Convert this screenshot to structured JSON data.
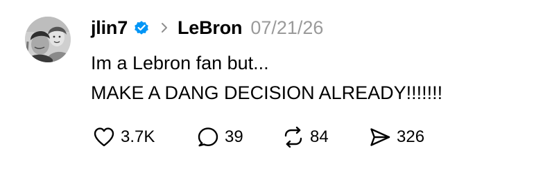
{
  "post": {
    "author": {
      "username": "jlin7",
      "verified": true,
      "avatar": "profile-photo"
    },
    "community": "LeBron",
    "timestamp": "07/21/26",
    "text_lines": [
      "Im a Lebron fan but...",
      "MAKE A DANG DECISION ALREADY!!!!!!!"
    ],
    "actions": {
      "like": {
        "icon": "heart-icon",
        "count": "3.7K"
      },
      "reply": {
        "icon": "reply-icon",
        "count": "39"
      },
      "repost": {
        "icon": "repost-icon",
        "count": "84"
      },
      "share": {
        "icon": "share-icon",
        "count": "326"
      }
    }
  },
  "colors": {
    "verified_badge": "#0095F6",
    "timestamp": "#9A9A9A",
    "text": "#000000"
  }
}
